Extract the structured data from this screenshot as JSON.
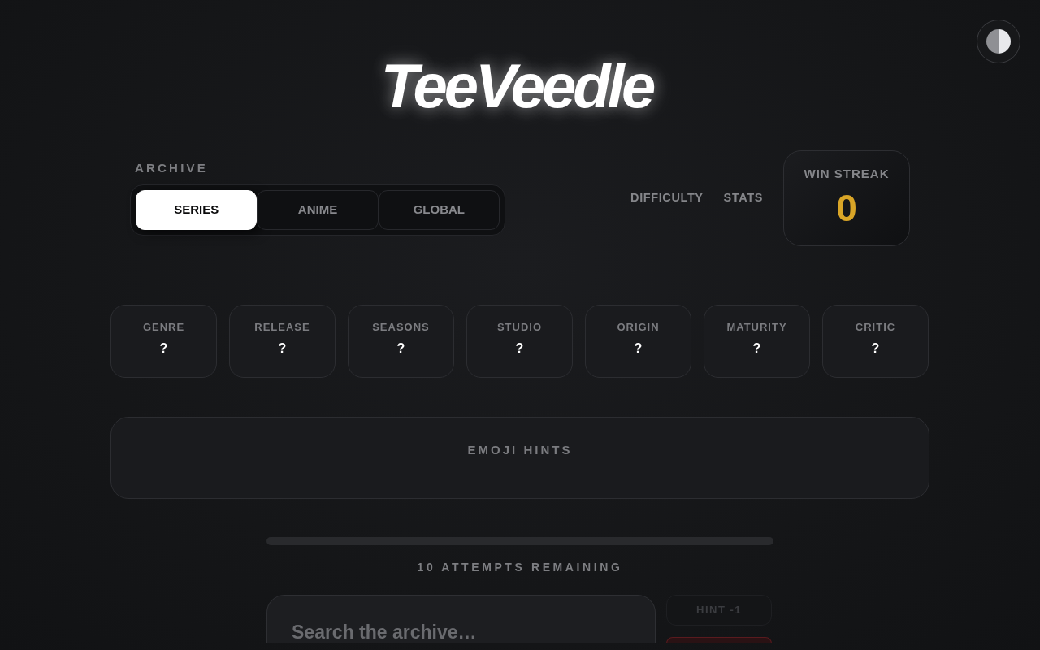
{
  "logo": "TeeVeedle",
  "archive": {
    "label": "ARCHIVE",
    "tabs": [
      {
        "label": "SERIES",
        "selected": true
      },
      {
        "label": "ANIME",
        "selected": false
      },
      {
        "label": "GLOBAL",
        "selected": false
      }
    ]
  },
  "nav_links": [
    "DIFFICULTY",
    "STATS"
  ],
  "win_streak": {
    "label": "WIN STREAK",
    "value": "0"
  },
  "attributes": [
    {
      "label": "GENRE",
      "value": "?"
    },
    {
      "label": "RELEASE",
      "value": "?"
    },
    {
      "label": "SEASONS",
      "value": "?"
    },
    {
      "label": "STUDIO",
      "value": "?"
    },
    {
      "label": "ORIGIN",
      "value": "?"
    },
    {
      "label": "MATURITY",
      "value": "?"
    },
    {
      "label": "CRITIC",
      "value": "?"
    }
  ],
  "emoji_hints": {
    "title": "EMOJI HINTS"
  },
  "attempts": "10 ATTEMPTS REMAINING",
  "search": {
    "placeholder": "Search the archive…"
  },
  "hint_button": {
    "label": "HINT -1",
    "disabled": true
  }
}
